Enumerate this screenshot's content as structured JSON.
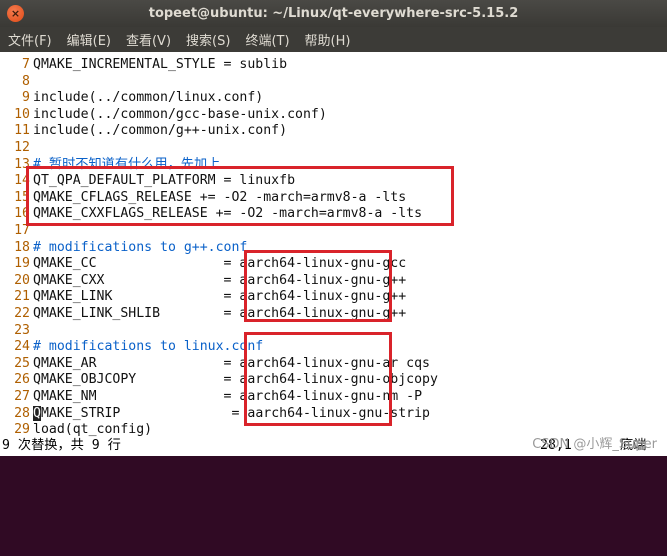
{
  "window": {
    "title": "topeet@ubuntu: ~/Linux/qt-everywhere-src-5.15.2",
    "close_glyph": "×"
  },
  "menu": [
    "文件(F)",
    "编辑(E)",
    "查看(V)",
    "搜索(S)",
    "终端(T)",
    "帮助(H)"
  ],
  "lines": [
    {
      "num": "7",
      "text": "QMAKE_INCREMENTAL_STYLE = sublib",
      "kind": "code"
    },
    {
      "num": "8",
      "text": "",
      "kind": "code"
    },
    {
      "num": "9",
      "text": "include(../common/linux.conf)",
      "kind": "code"
    },
    {
      "num": "10",
      "text": "include(../common/gcc-base-unix.conf)",
      "kind": "code"
    },
    {
      "num": "11",
      "text": "include(../common/g++-unix.conf)",
      "kind": "code"
    },
    {
      "num": "12",
      "text": "",
      "kind": "code"
    },
    {
      "num": "13",
      "text": "# 暂时不知道有什么用，先加上",
      "kind": "comment"
    },
    {
      "num": "14",
      "text": "QT_QPA_DEFAULT_PLATFORM = linuxfb",
      "kind": "code"
    },
    {
      "num": "15",
      "text": "QMAKE_CFLAGS_RELEASE += -O2 -march=armv8-a -lts",
      "kind": "code"
    },
    {
      "num": "16",
      "text": "QMAKE_CXXFLAGS_RELEASE += -O2 -march=armv8-a -lts",
      "kind": "code"
    },
    {
      "num": "17",
      "text": "",
      "kind": "code"
    },
    {
      "num": "18",
      "text": "# modifications to g++.conf",
      "kind": "comment"
    },
    {
      "num": "19",
      "text": "QMAKE_CC                = aarch64-linux-gnu-gcc",
      "kind": "code"
    },
    {
      "num": "20",
      "text": "QMAKE_CXX               = aarch64-linux-gnu-g++",
      "kind": "code"
    },
    {
      "num": "21",
      "text": "QMAKE_LINK              = aarch64-linux-gnu-g++",
      "kind": "code"
    },
    {
      "num": "22",
      "text": "QMAKE_LINK_SHLIB        = aarch64-linux-gnu-g++",
      "kind": "code"
    },
    {
      "num": "23",
      "text": "",
      "kind": "code"
    },
    {
      "num": "24",
      "text": "# modifications to linux.conf",
      "kind": "comment"
    },
    {
      "num": "25",
      "text": "QMAKE_AR                = aarch64-linux-gnu-ar cqs",
      "kind": "code"
    },
    {
      "num": "26",
      "text": "QMAKE_OBJCOPY           = aarch64-linux-gnu-objcopy",
      "kind": "code"
    },
    {
      "num": "27",
      "text": "QMAKE_NM                = aarch64-linux-gnu-nm -P",
      "kind": "code"
    },
    {
      "num": "28",
      "text": "MAKE_STRIP              = aarch64-linux-gnu-strip",
      "kind": "code",
      "cursor": "Q"
    },
    {
      "num": "29",
      "text": "load(qt_config)",
      "kind": "code"
    }
  ],
  "status": {
    "message": "9 次替换，共 9 行",
    "position": "28,1",
    "where": "底端"
  },
  "watermark": "CSDN @小辉_Super",
  "colors": {
    "line_number": "#af5f00",
    "comment": "#0a61c9",
    "highlight_box": "#d9232a"
  }
}
